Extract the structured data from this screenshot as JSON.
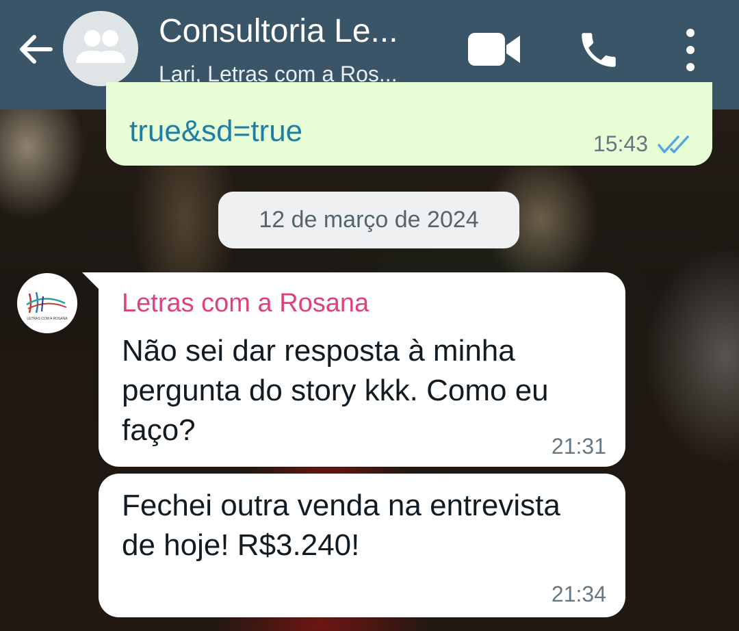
{
  "header": {
    "title": "Consultoria Le...",
    "subtitle": "Lari, Letras com a Ros...",
    "back_icon": "arrow-left-icon",
    "avatar_icon": "group-icon",
    "video_icon": "video-camera-icon",
    "call_icon": "phone-icon",
    "menu_icon": "more-vertical-icon",
    "background_color": "#3a5567"
  },
  "messages": {
    "outgoing": {
      "text": "true&sd=true",
      "time": "15:43",
      "status_icon": "double-check-read-icon",
      "link_color": "#1d7fa8",
      "bubble_color": "#e7fdd6"
    },
    "date_divider": "12 de março de 2024",
    "incoming": [
      {
        "sender": "Letras com a Rosana",
        "sender_color": "#e0407f",
        "avatar_logo_text": "LETRAS COM A ROSANA",
        "text": "Não sei dar resposta à minha pergunta do story kkk. Como eu faço?",
        "time": "21:31"
      },
      {
        "text": "Fechei outra venda na entrevista de hoje! R$3.240!",
        "time": "21:34"
      }
    ]
  }
}
